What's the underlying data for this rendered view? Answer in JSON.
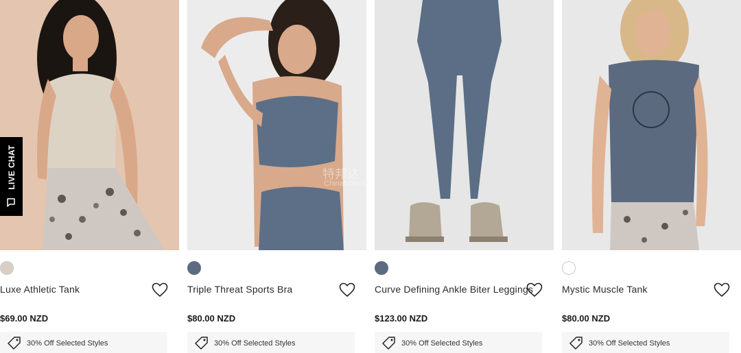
{
  "products": [
    {
      "name": "Luxe Athletic Tank",
      "price": "$69.00 NZD",
      "promo": "30% Off Selected Styles",
      "swatch_color": "#d8cfc2"
    },
    {
      "name": "Triple Threat Sports Bra",
      "price": "$80.00 NZD",
      "promo": "30% Off Selected Styles",
      "swatch_color": "#5b6c82"
    },
    {
      "name": "Curve Defining Ankle Biter Leggings",
      "price": "$123.00 NZD",
      "promo": "30% Off Selected Styles",
      "swatch_color": "#5b6c82"
    },
    {
      "name": "Mystic Muscle Tank",
      "price": "$80.00 NZD",
      "promo": "30% Off Selected Styles",
      "swatch_color": "#ffffff"
    }
  ],
  "live_chat": {
    "label": "LIVE CHAT",
    "icon": "chat-bubble-icon"
  },
  "watermark": {
    "text": "特邦达",
    "subtext": "Chinabrands"
  },
  "icons": {
    "wishlist": "heart-icon",
    "promo": "price-tag-icon"
  }
}
